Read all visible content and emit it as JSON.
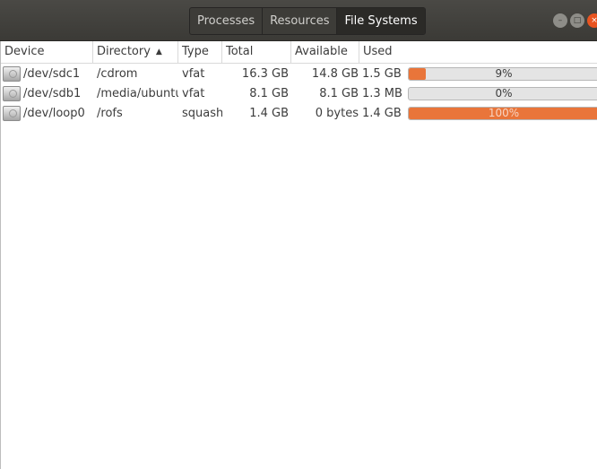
{
  "tabs": [
    "Processes",
    "Resources",
    "File Systems"
  ],
  "active_tab": "File Systems",
  "window_controls": {
    "minimize": "–",
    "maximize": "□",
    "close": "×"
  },
  "columns": {
    "device": "Device",
    "directory": "Directory",
    "directory_sort": "▲",
    "type": "Type",
    "total": "Total",
    "available": "Available",
    "used": "Used"
  },
  "rows": [
    {
      "device": "/dev/sdc1",
      "directory": "/cdrom",
      "type": "vfat",
      "total": "16.3 GB",
      "available": "14.8 GB",
      "used": "1.5 GB",
      "used_percent_label": "9%",
      "used_fraction": 0.09,
      "icon": "drive-icon"
    },
    {
      "device": "/dev/sdb1",
      "directory": "/media/ubuntu",
      "type": "vfat",
      "total": "8.1 GB",
      "available": "8.1 GB",
      "used": "1.3 MB",
      "used_percent_label": "0%",
      "used_fraction": 0.0,
      "icon": "drive-icon"
    },
    {
      "device": "/dev/loop0",
      "directory": "/rofs",
      "type": "squashfs",
      "total": "1.4 GB",
      "available": "0 bytes",
      "used": "1.4 GB",
      "used_percent_label": "100%",
      "used_fraction": 1.0,
      "icon": "drive-icon"
    }
  ],
  "colors": {
    "accent": "#e9753a",
    "titlebar": "#3b3a36",
    "close_button": "#e95420"
  }
}
